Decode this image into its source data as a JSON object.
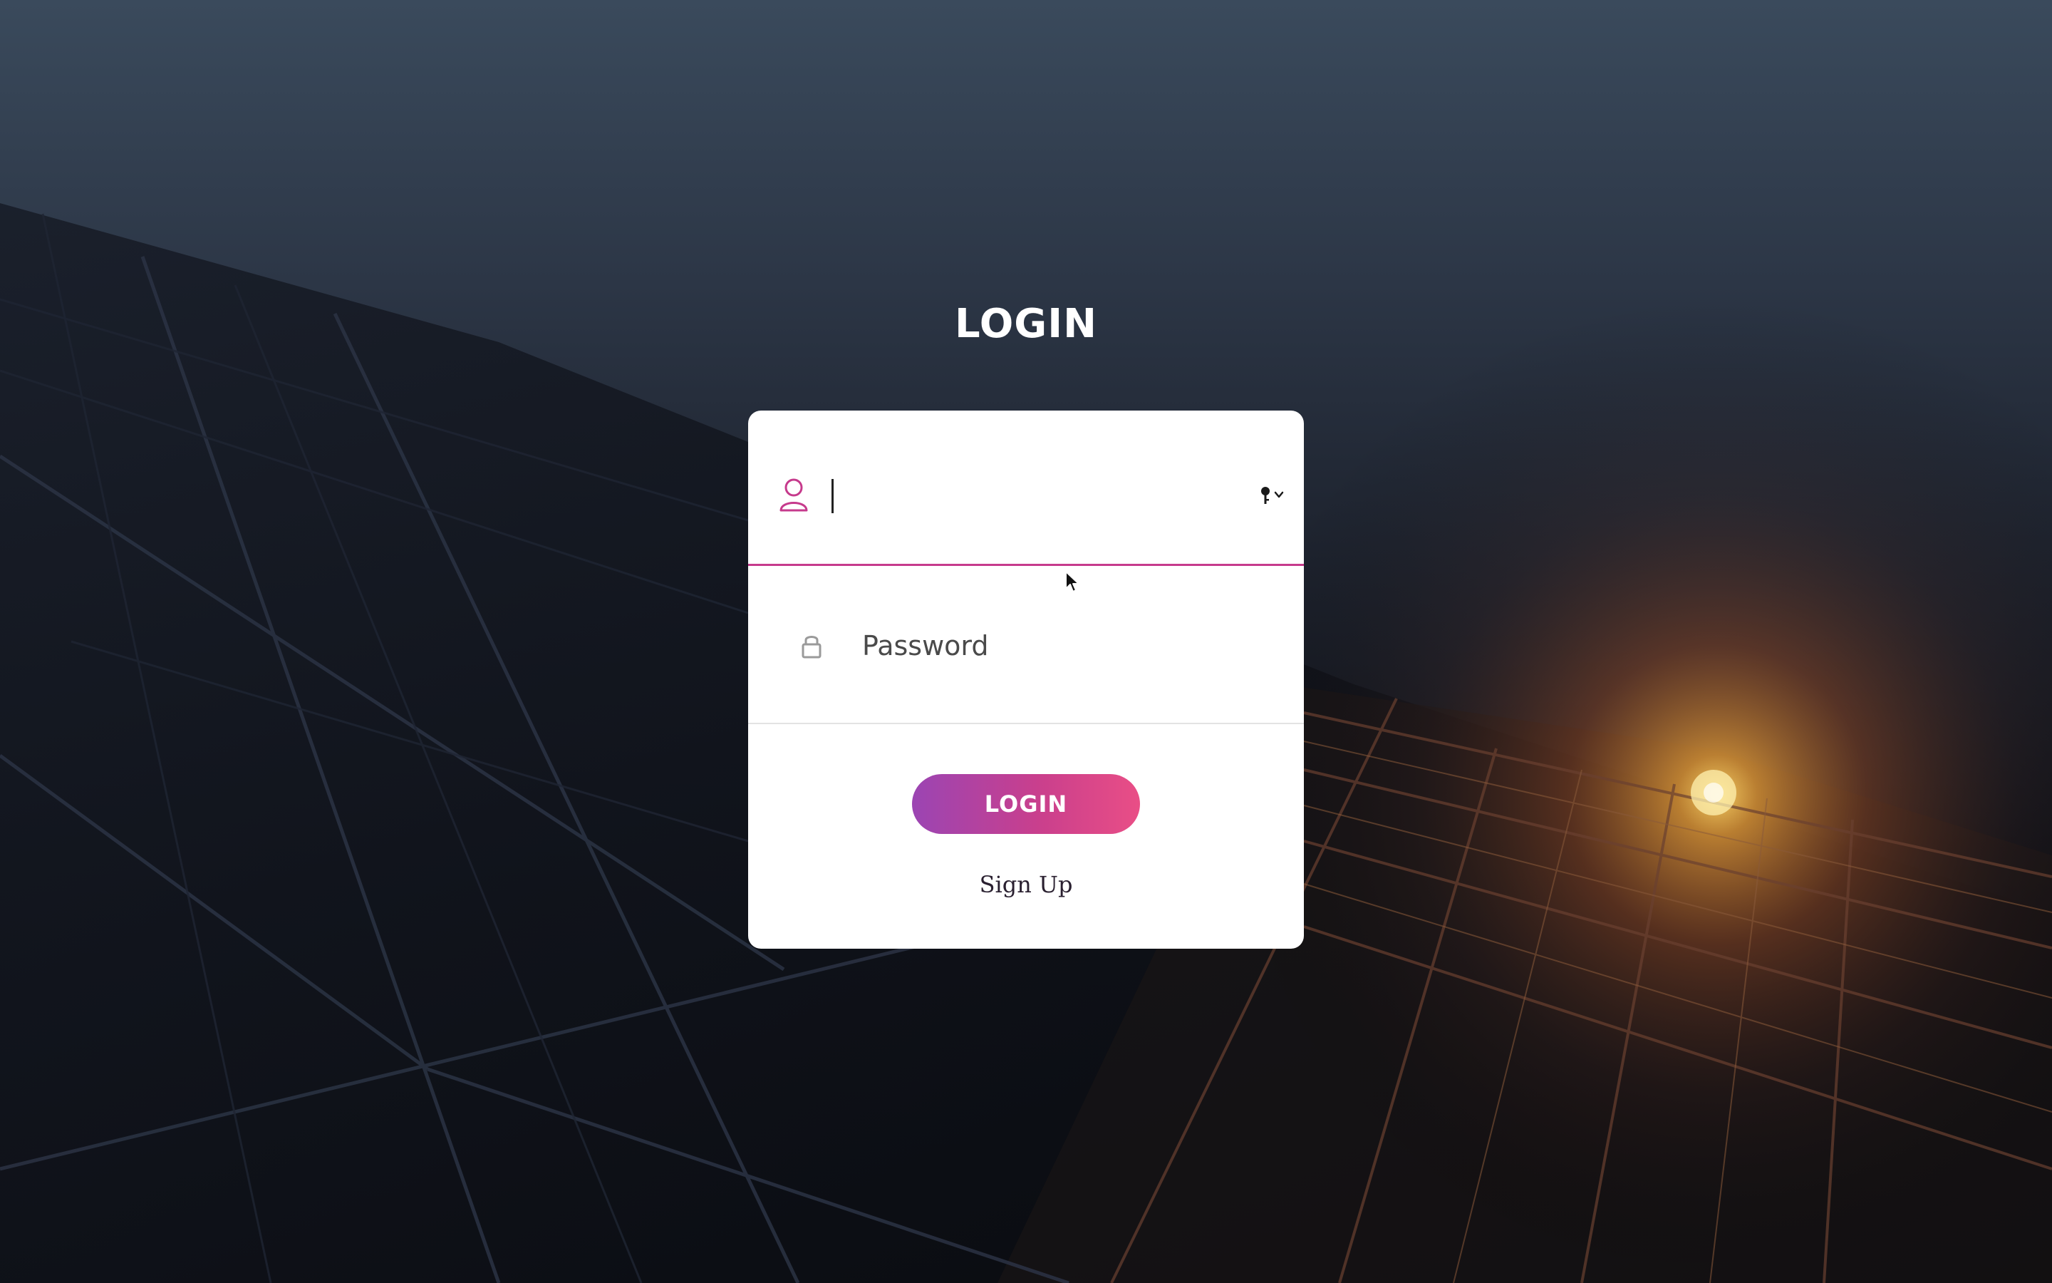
{
  "page": {
    "title": "LOGIN"
  },
  "form": {
    "username": {
      "value": "",
      "icon": "user-icon"
    },
    "password": {
      "placeholder": "Password",
      "icon": "lock-icon"
    },
    "key_menu_icon": "key-dropdown-icon",
    "login_button_label": "LOGIN",
    "signup_link_label": "Sign Up"
  },
  "colors": {
    "accent": "#c63a8c",
    "button_gradient_start": "#9b45b3",
    "button_gradient_end": "#e94e86",
    "card_background": "#ffffff",
    "title_text": "#ffffff"
  }
}
